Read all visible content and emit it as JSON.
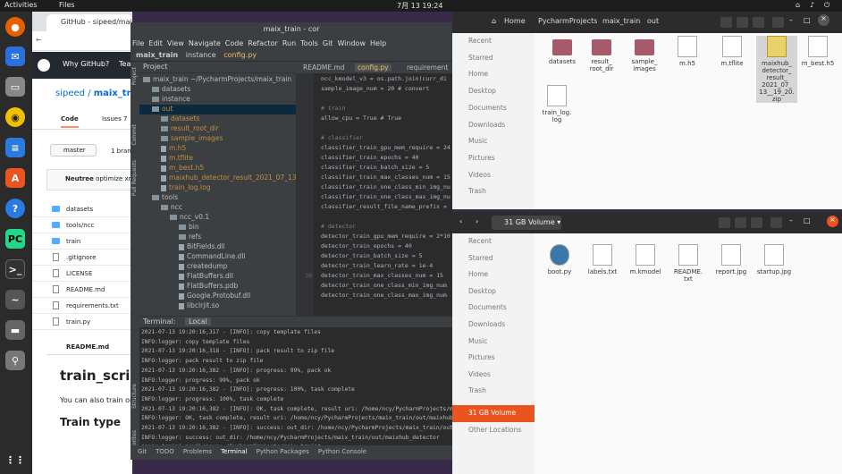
{
  "topbar": {
    "activities": "Activities",
    "app": "Files",
    "clock": "7月 13  19:24"
  },
  "browser": {
    "tab_title": "GitHub - sipeed/maix_tr",
    "owner": "sipeed",
    "slash": "/",
    "repo": "maix_train",
    "nav_why": "Why GitHub?",
    "nav_team": "Team",
    "tab_code": "Code",
    "tab_issues": "Issues",
    "issues_count": "7",
    "branch": "master",
    "branch_count": "1 branch",
    "commit_author": "Neutree",
    "commit_msg": "optimize xml",
    "files": [
      "datasets",
      "tools/ncc",
      "train",
      ".gitignore",
      "LICENSE",
      "README.md",
      "requirements.txt",
      "train.py"
    ],
    "readme_header": "README.md",
    "readme_title": "train_scrip",
    "readme_text": "You can also train on",
    "readme_h2": "Train type"
  },
  "pycharm": {
    "title": "maix_train - cor",
    "menu": [
      "File",
      "Edit",
      "View",
      "Navigate",
      "Code",
      "Refactor",
      "Run",
      "Tools",
      "Git",
      "Window",
      "Help"
    ],
    "bread": [
      "maix_train",
      "instance",
      "config.py"
    ],
    "project_label": "Project",
    "tree": [
      {
        "t": "maix_train ~/PycharmProjects/maix_train",
        "k": "fol",
        "i": 0
      },
      {
        "t": "datasets",
        "k": "fol",
        "i": 1
      },
      {
        "t": "instance",
        "k": "fol",
        "i": 1
      },
      {
        "t": "out",
        "k": "fol",
        "i": 1
      },
      {
        "t": "datasets",
        "k": "fol",
        "i": 2
      },
      {
        "t": "result_root_dir",
        "k": "fol",
        "i": 2
      },
      {
        "t": "sample_images",
        "k": "fol",
        "i": 2
      },
      {
        "t": "m.h5",
        "k": "fil",
        "i": 2
      },
      {
        "t": "m.tflite",
        "k": "fil",
        "i": 2
      },
      {
        "t": "m_best.h5",
        "k": "fil",
        "i": 2
      },
      {
        "t": "maixhub_detector_result_2021_07_13_",
        "k": "fil",
        "i": 2
      },
      {
        "t": "train_log.log",
        "k": "fil",
        "i": 2
      },
      {
        "t": "tools",
        "k": "fol",
        "i": 1
      },
      {
        "t": "ncc",
        "k": "fol",
        "i": 2
      },
      {
        "t": "ncc_v0.1",
        "k": "fol",
        "i": 3
      },
      {
        "t": "bin",
        "k": "fol",
        "i": 4
      },
      {
        "t": "refs",
        "k": "fol",
        "i": 4
      },
      {
        "t": "BitFields.dll",
        "k": "fil",
        "i": 4
      },
      {
        "t": "CommandLine.dll",
        "k": "fil",
        "i": 4
      },
      {
        "t": "createdump",
        "k": "fil",
        "i": 4
      },
      {
        "t": "FlatBuffers.dll",
        "k": "fil",
        "i": 4
      },
      {
        "t": "FlatBuffers.pdb",
        "k": "fil",
        "i": 4
      },
      {
        "t": "Google.Protobuf.dll",
        "k": "fil",
        "i": 4
      },
      {
        "t": "libclrjit.so",
        "k": "fil",
        "i": 4
      }
    ],
    "editor_tabs": [
      "README.md",
      "config.py",
      "requirement"
    ],
    "code": [
      {
        "n": "",
        "t": "ncc_kmodel_v3 = os.path.join(curr_di"
      },
      {
        "n": "",
        "t": "sample_image_num = 20       # convert"
      },
      {
        "n": "",
        "t": ""
      },
      {
        "n": "",
        "t": "# train"
      },
      {
        "n": "",
        "t": "allow_cpu = True # True"
      },
      {
        "n": "",
        "t": ""
      },
      {
        "n": "",
        "t": "# classifier"
      },
      {
        "n": "",
        "t": "classifier_train_gpu_mem_require = 24"
      },
      {
        "n": "",
        "t": "classifier_train_epochs = 40"
      },
      {
        "n": "",
        "t": "classifier_train_batch_size = 5"
      },
      {
        "n": "",
        "t": "classifier_train_max_classes_num = 15"
      },
      {
        "n": "",
        "t": "classifier_train_one_class_min_img_nu"
      },
      {
        "n": "",
        "t": "classifier_train_one_class_max_img_nu"
      },
      {
        "n": "",
        "t": "classifier_result_file_name_prefix ="
      },
      {
        "n": "",
        "t": ""
      },
      {
        "n": "",
        "t": "# detector"
      },
      {
        "n": "",
        "t": "detector_train_gpu_mem_require = 2*10"
      },
      {
        "n": "",
        "t": "detector_train_epochs = 40"
      },
      {
        "n": "",
        "t": "detector_train_batch_size = 5"
      },
      {
        "n": "",
        "t": "detector_train_learn_rate = 1e-4"
      },
      {
        "n": "38",
        "t": "detector_train_max_classes_num = 15"
      },
      {
        "n": "",
        "t": "detector_train_one_class_min_img_num"
      },
      {
        "n": "",
        "t": "detector_train_one_class_max_img_num"
      }
    ],
    "terminal_tab": "Terminal:",
    "terminal_local": "Local",
    "terminal": [
      "2021-07-13 19:20:16,317 - [INFO]:  copy template files",
      "INFO:logger: copy template files",
      "2021-07-13 19:20:16,318 - [INFO]:  pack result to zip file",
      "INFO:logger: pack result to zip file",
      "2021-07-13 19:20:16,382 - [INFO]:  progress: 99%, pack ok",
      "INFO:logger: progress: 99%, pack ok",
      "2021-07-13 19:20:16,382 - [INFO]:  progress: 100%, task complete",
      "INFO:logger: progress: 100%, task complete",
      "2021-07-13 19:20:16,382 - [INFO]:  OK, task complete, result uri: /home/ncy/PycharmProjects/maix_train/out/mai",
      "INFO:logger: OK, task complete, result uri: /home/ncy/PycharmProjects/maix_train/out/maixhub_detector_result_2",
      "2021-07-13 19:20:16,382 - [INFO]:  success: out_dir: /home/ncy/PycharmProjects/maix_train/out",
      "INFO:logger: success: out_dir: /home/ncy/PycharmProjects/maix_train/out/maixhub_detector",
      "(maix_train) ncy@Lenovo:~/PycharmProjects/maix_train$ "
    ],
    "status": [
      "Git",
      "TODO",
      "Problems",
      "Terminal",
      "Python Packages",
      "Python Console"
    ],
    "side_labels": [
      "Project",
      "Commit",
      "Pull Requests",
      "Structure",
      "Favorites"
    ]
  },
  "nautilus_top": {
    "crumbs": [
      "Home",
      "PycharmProjects",
      "maix_train",
      "out"
    ],
    "sidebar": [
      "Recent",
      "Starred",
      "Home",
      "Desktop",
      "Documents",
      "Downloads",
      "Music",
      "Pictures",
      "Videos",
      "Trash"
    ],
    "files": [
      {
        "name": "datasets",
        "type": "folder"
      },
      {
        "name": "result_\nroot_dir",
        "type": "folder"
      },
      {
        "name": "sample_\nimages",
        "type": "folder"
      },
      {
        "name": "m.h5",
        "type": "doc"
      },
      {
        "name": "m.tflite",
        "type": "doc"
      },
      {
        "name": "maixhub_\ndetector_\nresult_\n2021_07_\n13__19_20.\nzip",
        "type": "zip"
      },
      {
        "name": "m_best.h5",
        "type": "doc"
      },
      {
        "name": "train_log.\nlog",
        "type": "doc"
      }
    ]
  },
  "nautilus_bottom": {
    "location": "31 GB Volume",
    "sidebar": [
      "Recent",
      "Starred",
      "Home",
      "Desktop",
      "Documents",
      "Downloads",
      "Music",
      "Pictures",
      "Videos",
      "Trash",
      "31 GB Volume",
      "Other Locations"
    ],
    "files": [
      "boot.py",
      "labels.txt",
      "m.kmodel",
      "README.\ntxt",
      "report.jpg",
      "startup.jpg"
    ]
  },
  "colors": {
    "accent": "#e95420",
    "dock": "#2b2b2b",
    "pycharm_bg": "#2b2b2b"
  }
}
